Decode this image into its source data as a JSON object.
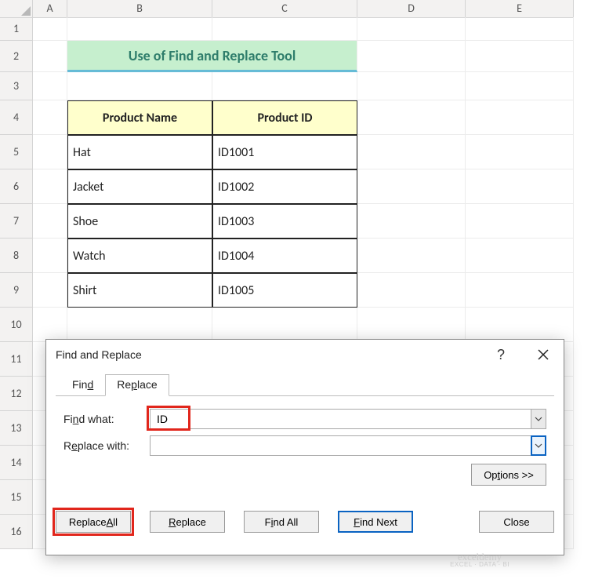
{
  "columns": [
    "A",
    "B",
    "C",
    "D",
    "E"
  ],
  "rows": [
    "1",
    "2",
    "3",
    "4",
    "5",
    "6",
    "7",
    "8",
    "9",
    "10",
    "11",
    "12",
    "13",
    "14",
    "15",
    "16"
  ],
  "title": "Use of Find and Replace Tool",
  "table": {
    "headers": [
      "Product Name",
      "Product ID"
    ],
    "rows": [
      [
        "Hat",
        "ID1001"
      ],
      [
        "Jacket",
        "ID1002"
      ],
      [
        "Shoe",
        "ID1003"
      ],
      [
        "Watch",
        "ID1004"
      ],
      [
        "Shirt",
        "ID1005"
      ]
    ]
  },
  "dialog": {
    "title": "Find and Replace",
    "tabs": {
      "find": "Find",
      "replace": "Replace",
      "active": "Replace"
    },
    "find_label_pre": "Fi",
    "find_label_u": "n",
    "find_label_post": "d what:",
    "replace_label_pre": "R",
    "replace_label_u": "e",
    "replace_label_post": "place with:",
    "find_value": "ID",
    "replace_value": "",
    "options_pre": "Op",
    "options_u": "t",
    "options_post": "ions >>",
    "buttons": {
      "replace_all_pre": "Replace ",
      "replace_all_u": "A",
      "replace_all_post": "ll",
      "replace_u": "R",
      "replace_post": "eplace",
      "find_all_pre": "F",
      "find_all_u": "i",
      "find_all_post": "nd All",
      "find_next_u": "F",
      "find_next_post": "ind Next",
      "close": "Close"
    }
  },
  "watermark": {
    "main": "exceldemy",
    "sub": "EXCEL · DATA · BI"
  }
}
